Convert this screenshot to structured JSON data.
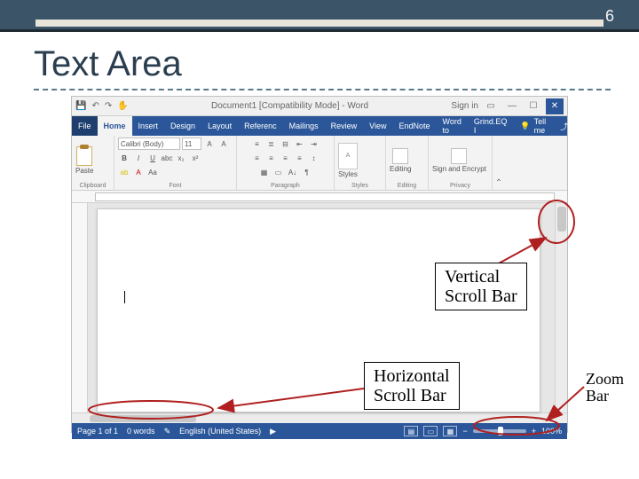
{
  "slide": {
    "page_number": "6",
    "title": "Text Area"
  },
  "word": {
    "titlebar": {
      "document_title": "Document1 [Compatibility Mode] - Word",
      "sign_in": "Sign in",
      "qat": {
        "save": "💾",
        "undo": "↶",
        "redo": "↷",
        "touch": "✋"
      }
    },
    "tabs": {
      "file": "File",
      "home": "Home",
      "insert": "Insert",
      "design": "Design",
      "layout": "Layout",
      "references": "Referenc",
      "mailings": "Mailings",
      "review": "Review",
      "view": "View",
      "endnote": "EndNote",
      "wordto": "Word to",
      "grindeq": "Grind.EQ I",
      "tell_me": "Tell me",
      "share": "⤴"
    },
    "ribbon": {
      "clipboard_label": "Clipboard",
      "paste": "Paste",
      "font_label": "Font",
      "font_name": "Calibri (Body)",
      "font_size": "11",
      "paragraph_label": "Paragraph",
      "styles_label": "Styles",
      "styles_btn": "Styles",
      "editing_label": "Editing",
      "editing_btn": "Editing",
      "privacy_label": "Privacy",
      "privacy_btn": "Sign and Encrypt"
    },
    "statusbar": {
      "page": "Page 1 of 1",
      "words": "0 words",
      "lang": "English (United States)",
      "zoom_pct": "100%"
    }
  },
  "callouts": {
    "vertical": "Vertical\nScroll Bar",
    "horizontal": "Horizontal\nScroll Bar",
    "zoom": "Zoom\nBar"
  }
}
